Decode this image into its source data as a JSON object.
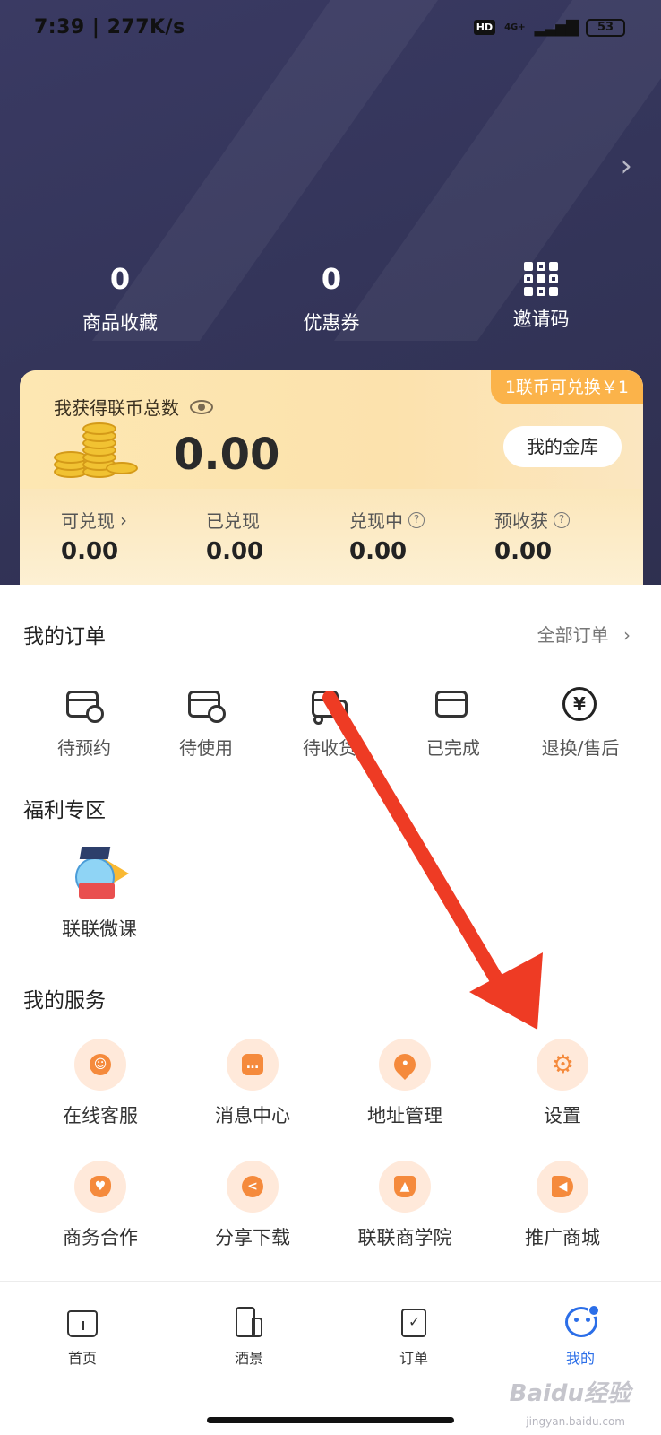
{
  "status_bar": {
    "time": "7:39 | 277K/s",
    "hd": "HD",
    "network": "4G+",
    "battery": "53"
  },
  "stats": [
    {
      "value": "0",
      "label": "商品收藏"
    },
    {
      "value": "0",
      "label": "优惠券"
    },
    {
      "icon": "qr-code-icon",
      "label": "邀请码"
    }
  ],
  "coins": {
    "title": "我获得联币总数",
    "rate_tag": "1联币可兑换￥1",
    "total": "0.00",
    "vault_button": "我的金库",
    "items": [
      {
        "label": "可兑现",
        "value": "0.00"
      },
      {
        "label": "已兑现",
        "value": "0.00"
      },
      {
        "label": "兑现中",
        "value": "0.00"
      },
      {
        "label": "预收获",
        "value": "0.00"
      }
    ]
  },
  "orders": {
    "title": "我的订单",
    "all_link": "全部订单",
    "items": [
      {
        "label": "待预约",
        "icon": "wallet-clock-icon"
      },
      {
        "label": "待使用",
        "icon": "wallet-hourglass-icon"
      },
      {
        "label": "待收货",
        "icon": "truck-icon"
      },
      {
        "label": "已完成",
        "icon": "wallet-check-icon"
      },
      {
        "label": "退换/售后",
        "icon": "refund-icon"
      }
    ]
  },
  "welfare": {
    "title": "福利专区",
    "items": [
      {
        "label": "联联微课",
        "icon": "micro-course-icon"
      }
    ]
  },
  "services": {
    "title": "我的服务",
    "items": [
      {
        "label": "在线客服",
        "icon": "customer-service-icon"
      },
      {
        "label": "消息中心",
        "icon": "message-icon"
      },
      {
        "label": "地址管理",
        "icon": "location-pin-icon"
      },
      {
        "label": "设置",
        "icon": "gear-icon"
      },
      {
        "label": "商务合作",
        "icon": "handshake-icon"
      },
      {
        "label": "分享下载",
        "icon": "share-icon"
      },
      {
        "label": "联联商学院",
        "icon": "graduation-cap-icon"
      },
      {
        "label": "推广商城",
        "icon": "megaphone-icon"
      }
    ]
  },
  "tabbar": {
    "items": [
      {
        "label": "首页",
        "icon": "home-icon"
      },
      {
        "label": "酒景",
        "icon": "hotel-scenic-icon"
      },
      {
        "label": "订单",
        "icon": "clipboard-check-icon"
      },
      {
        "label": "我的",
        "icon": "profile-face-icon",
        "active": true
      }
    ]
  },
  "watermark": {
    "text": "Baidu经验",
    "sub": "jingyan.baidu.com"
  },
  "colors": {
    "hero": "#34355a",
    "accent": "#f58a3c",
    "tab_active": "#2b6ee8",
    "rate_tag": "#fbb34a",
    "annotation_arrow": "#ee3b24"
  }
}
